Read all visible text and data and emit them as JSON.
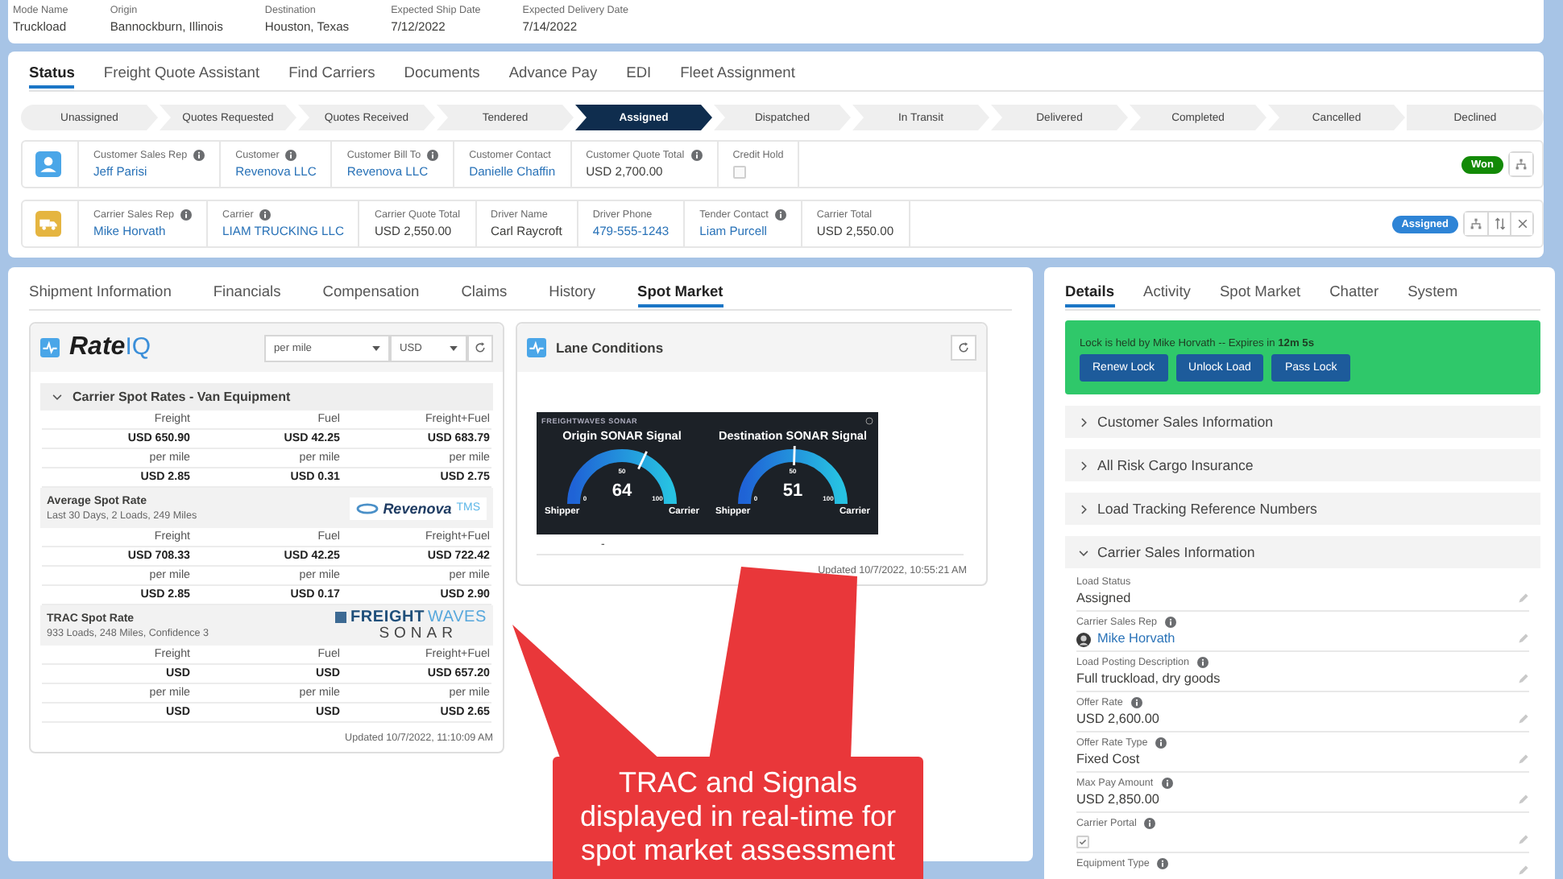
{
  "header_fields": [
    {
      "label": "Mode Name",
      "value": "Truckload"
    },
    {
      "label": "Origin",
      "value": "Bannockburn, Illinois"
    },
    {
      "label": "Destination",
      "value": "Houston, Texas"
    },
    {
      "label": "Expected Ship Date",
      "value": "7/12/2022"
    },
    {
      "label": "Expected Delivery Date",
      "value": "7/14/2022"
    }
  ],
  "status_tabs": [
    {
      "label": "Status",
      "selected": true
    },
    {
      "label": "Freight Quote Assistant",
      "selected": false
    },
    {
      "label": "Find Carriers",
      "selected": false
    },
    {
      "label": "Documents",
      "selected": false
    },
    {
      "label": "Advance Pay",
      "selected": false
    },
    {
      "label": "EDI",
      "selected": false
    },
    {
      "label": "Fleet Assignment",
      "selected": false
    }
  ],
  "path": [
    {
      "label": "Unassigned",
      "selected": false
    },
    {
      "label": "Quotes Requested",
      "selected": false
    },
    {
      "label": "Quotes Received",
      "selected": false
    },
    {
      "label": "Tendered",
      "selected": false
    },
    {
      "label": "Assigned",
      "selected": true
    },
    {
      "label": "Dispatched",
      "selected": false
    },
    {
      "label": "In Transit",
      "selected": false
    },
    {
      "label": "Delivered",
      "selected": false
    },
    {
      "label": "Completed",
      "selected": false
    },
    {
      "label": "Cancelled",
      "selected": false
    },
    {
      "label": "Declined",
      "selected": false
    }
  ],
  "summary_rows": [
    {
      "fields": [
        {
          "label": "Customer Sales Rep",
          "info": true,
          "kind": "link",
          "value": "Jeff Parisi"
        },
        {
          "label": "Customer",
          "info": true,
          "kind": "link",
          "value": "Revenova LLC"
        },
        {
          "label": "Customer Bill To",
          "info": true,
          "kind": "link",
          "value": "Revenova LLC"
        },
        {
          "label": "Customer Contact",
          "info": false,
          "kind": "link",
          "value": "Danielle Chaffin"
        },
        {
          "label": "Customer Quote Total",
          "info": true,
          "kind": "text",
          "value": "USD 2,700.00"
        },
        {
          "label": "Credit Hold",
          "info": false,
          "kind": "checkbox",
          "checked": false
        }
      ],
      "badge": {
        "label": "Won",
        "color": "#138a07"
      }
    },
    {
      "fields": [
        {
          "label": "Carrier Sales Rep",
          "info": true,
          "kind": "link",
          "value": "Mike Horvath"
        },
        {
          "label": "Carrier",
          "info": true,
          "kind": "link",
          "value": "LIAM TRUCKING LLC"
        },
        {
          "label": "Carrier Quote Total",
          "info": false,
          "kind": "text",
          "value": "USD 2,550.00"
        },
        {
          "label": "Driver Name",
          "info": false,
          "kind": "text",
          "value": "Carl Raycroft"
        },
        {
          "label": "Driver Phone",
          "info": false,
          "kind": "link",
          "value": "479-555-1243"
        },
        {
          "label": "Tender Contact",
          "info": true,
          "kind": "link",
          "value": "Liam Purcell"
        },
        {
          "label": "Carrier Total",
          "info": false,
          "kind": "text",
          "value": "USD 2,550.00"
        }
      ],
      "badge": {
        "label": "Assigned",
        "color": "#2e84d6"
      }
    }
  ],
  "left_tabs": [
    {
      "label": "Shipment Information",
      "selected": false
    },
    {
      "label": "Financials",
      "selected": false
    },
    {
      "label": "Compensation",
      "selected": false
    },
    {
      "label": "Claims",
      "selected": false
    },
    {
      "label": "History",
      "selected": false
    },
    {
      "label": "Spot Market",
      "selected": true
    }
  ],
  "rate_iq": {
    "title": "Rate",
    "title_accent": "IQ",
    "unit": "per mile",
    "currency": "USD",
    "section": {
      "title": "Carrier Spot Rates - Van Equipment",
      "expanded": true
    },
    "blocks": [
      {
        "rows": [
          {
            "kind": "label",
            "cells": [
              "Freight",
              "Fuel",
              "Freight+Fuel"
            ]
          },
          {
            "kind": "value",
            "cells": [
              "USD 650.90",
              "USD 42.25",
              "USD 683.79"
            ]
          },
          {
            "kind": "label",
            "cells": [
              "per mile",
              "per mile",
              "per mile"
            ]
          },
          {
            "kind": "value",
            "cells": [
              "USD 2.85",
              "USD 0.31",
              "USD 2.75"
            ]
          }
        ]
      },
      {
        "title": "Average Spot Rate",
        "subtitle": "Last 30 Days, 2 Loads, 249 Miles",
        "logo": {
          "kind": "revenova",
          "parts": [
            "Revenova",
            "TMS"
          ]
        },
        "rows": [
          {
            "kind": "label",
            "cells": [
              "Freight",
              "Fuel",
              "Freight+Fuel"
            ]
          },
          {
            "kind": "value",
            "cells": [
              "USD 708.33",
              "USD 42.25",
              "USD 722.42"
            ]
          },
          {
            "kind": "label",
            "cells": [
              "per mile",
              "per mile",
              "per mile"
            ]
          },
          {
            "kind": "value",
            "cells": [
              "USD 2.85",
              "USD 0.17",
              "USD 2.90"
            ]
          }
        ]
      },
      {
        "title": "TRAC Spot Rate",
        "subtitle": "933 Loads, 248 Miles, Confidence 3",
        "logo": {
          "kind": "sonar",
          "parts": [
            "FREIGHT",
            "WAVES",
            "SONAR"
          ]
        },
        "rows": [
          {
            "kind": "label",
            "cells": [
              "Freight",
              "Fuel",
              "Freight+Fuel"
            ]
          },
          {
            "kind": "value",
            "cells": [
              "USD",
              "USD",
              "USD 657.20"
            ]
          },
          {
            "kind": "label",
            "cells": [
              "per mile",
              "per mile",
              "per mile"
            ]
          },
          {
            "kind": "value",
            "cells": [
              "USD",
              "USD",
              "USD 2.65"
            ]
          }
        ]
      }
    ],
    "updated": "Updated 10/7/2022, 11:10:09 AM"
  },
  "lane_conditions": {
    "title": "Lane Conditions",
    "widget": {
      "brand": "FREIGHTWAVES SONAR",
      "gauges": [
        {
          "title": "Origin SONAR Signal",
          "value": "64",
          "min": "0",
          "mid": "50",
          "max": "100",
          "left": "Shipper",
          "right": "Carrier"
        },
        {
          "title": "Destination SONAR Signal",
          "value": "51",
          "min": "0",
          "mid": "50",
          "max": "100",
          "left": "Shipper",
          "right": "Carrier"
        }
      ]
    },
    "note": "-",
    "updated": "Updated 10/7/2022, 10:55:21 AM"
  },
  "detail_tabs": [
    {
      "label": "Details",
      "selected": true
    },
    {
      "label": "Activity",
      "selected": false
    },
    {
      "label": "Spot Market",
      "selected": false
    },
    {
      "label": "Chatter",
      "selected": false
    },
    {
      "label": "System",
      "selected": false
    }
  ],
  "lock": {
    "message": "Lock is held by Mike Horvath -- Expires in **12m 5s**",
    "buttons": [
      "Renew Lock",
      "Unlock Load",
      "Pass Lock"
    ]
  },
  "sections": [
    {
      "title": "Customer Sales Information",
      "expanded": false
    },
    {
      "title": "All Risk Cargo Insurance",
      "expanded": false
    },
    {
      "title": "Load Tracking Reference Numbers",
      "expanded": false
    },
    {
      "title": "Carrier Sales Information",
      "expanded": true
    }
  ],
  "detail_fields": [
    {
      "label": "Load Status",
      "info": false,
      "kind": "text",
      "value": "Assigned"
    },
    {
      "label": "Carrier Sales Rep",
      "info": true,
      "kind": "user",
      "value": "Mike Horvath"
    },
    {
      "label": "Load Posting Description",
      "info": true,
      "kind": "text",
      "value": "Full truckload, dry goods"
    },
    {
      "label": "Offer Rate",
      "info": true,
      "kind": "text",
      "value": "USD 2,600.00"
    },
    {
      "label": "Offer Rate Type",
      "info": true,
      "kind": "text",
      "value": "Fixed Cost"
    },
    {
      "label": "Max Pay Amount",
      "info": true,
      "kind": "text",
      "value": "USD 2,850.00"
    },
    {
      "label": "Carrier Portal",
      "info": true,
      "kind": "checkbox",
      "checked": true
    },
    {
      "label": "Equipment Type",
      "info": true,
      "kind": "empty"
    }
  ],
  "callout": {
    "text": "TRAC and Signals displayed in real-time for spot market assessment"
  }
}
